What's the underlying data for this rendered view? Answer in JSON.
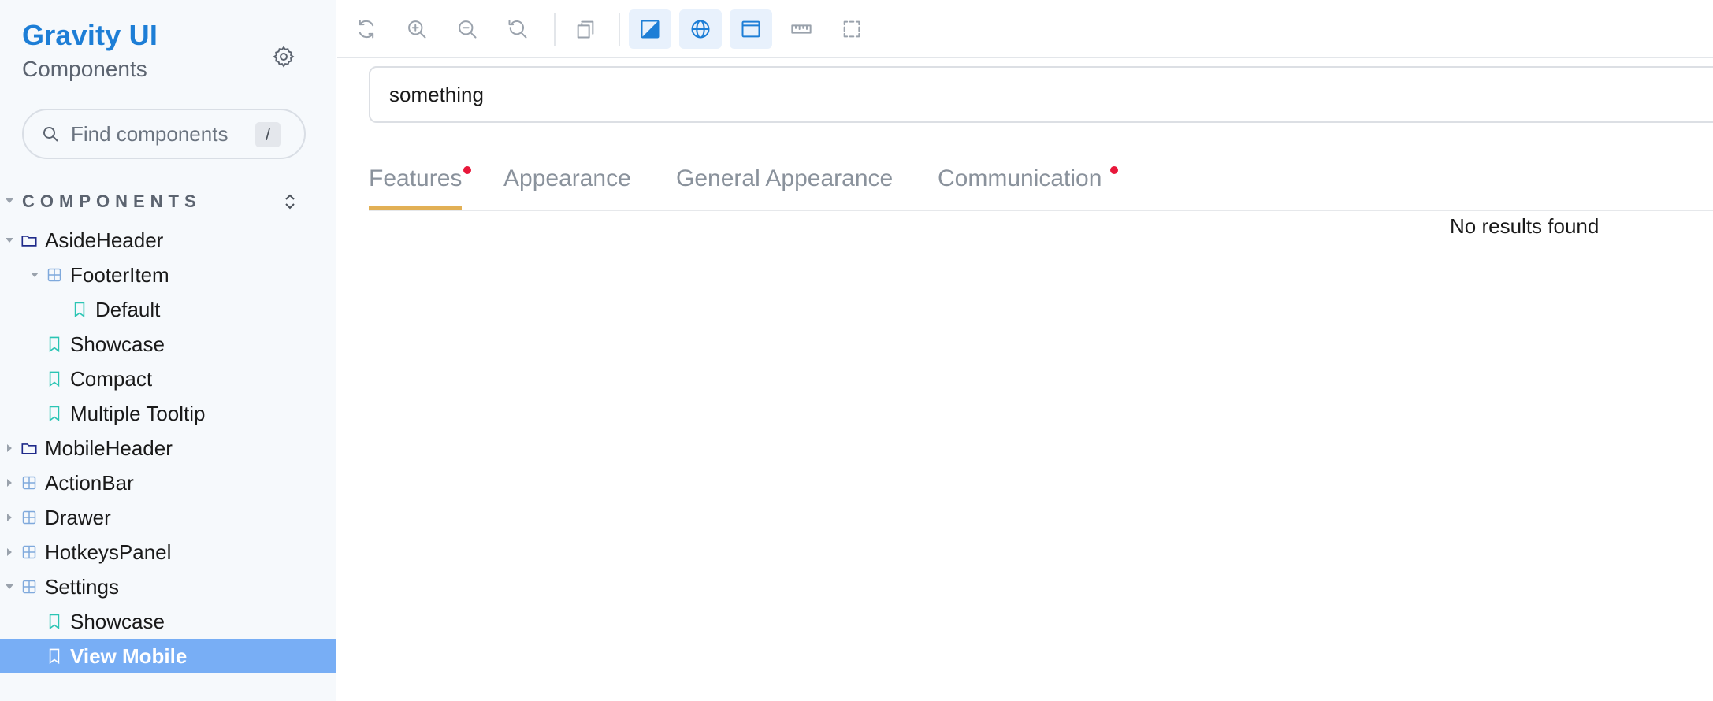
{
  "sidebar": {
    "brand": "Gravity UI",
    "subtitle": "Components",
    "search_placeholder": "Find components",
    "search_shortcut": "/",
    "section_title": "COMPONENTS",
    "tree": [
      {
        "label": "AsideHeader",
        "type": "folder",
        "depth": 0,
        "expanded": true
      },
      {
        "label": "FooterItem",
        "type": "component",
        "depth": 1,
        "expanded": true
      },
      {
        "label": "Default",
        "type": "story",
        "depth": 2
      },
      {
        "label": "Showcase",
        "type": "story",
        "depth": 1
      },
      {
        "label": "Compact",
        "type": "story",
        "depth": 1
      },
      {
        "label": "Multiple Tooltip",
        "type": "story",
        "depth": 1
      },
      {
        "label": "MobileHeader",
        "type": "folder",
        "depth": 0,
        "expanded": false
      },
      {
        "label": "ActionBar",
        "type": "component",
        "depth": 0,
        "expanded": false
      },
      {
        "label": "Drawer",
        "type": "component",
        "depth": 0,
        "expanded": false
      },
      {
        "label": "HotkeysPanel",
        "type": "component",
        "depth": 0,
        "expanded": false
      },
      {
        "label": "Settings",
        "type": "component",
        "depth": 0,
        "expanded": true
      },
      {
        "label": "Showcase",
        "type": "story",
        "depth": 1
      },
      {
        "label": "View Mobile",
        "type": "story",
        "depth": 1,
        "selected": true
      }
    ]
  },
  "toolbar": {
    "buttons": [
      {
        "icon": "remount-icon",
        "active": false
      },
      {
        "icon": "zoom-in-icon",
        "active": false
      },
      {
        "icon": "zoom-out-icon",
        "active": false
      },
      {
        "icon": "reset-zoom-icon",
        "active": false
      },
      {
        "icon": "layers-icon",
        "active": false
      },
      {
        "icon": "theme-icon",
        "active": true
      },
      {
        "icon": "globe-icon",
        "active": true
      },
      {
        "icon": "viewport-icon",
        "active": true
      },
      {
        "icon": "ruler-icon",
        "active": false
      },
      {
        "icon": "outline-icon",
        "active": false
      }
    ]
  },
  "main": {
    "search_value": "something",
    "tabs": [
      {
        "label": "Features",
        "active": true,
        "dot": true
      },
      {
        "label": "Appearance",
        "active": false,
        "dot": false
      },
      {
        "label": "General Appearance",
        "active": false,
        "dot": false
      },
      {
        "label": "Communication",
        "active": false,
        "dot": true
      }
    ],
    "empty_message": "No results found"
  },
  "colors": {
    "brand": "#1d7ed6",
    "selected_row": "#78aef5",
    "tab_underline": "#e2b055",
    "dot": "#e8173a",
    "story_icon": "#2bc5b4",
    "folder_icon": "#1f2a8a",
    "component_icon": "#7fa9dc"
  }
}
